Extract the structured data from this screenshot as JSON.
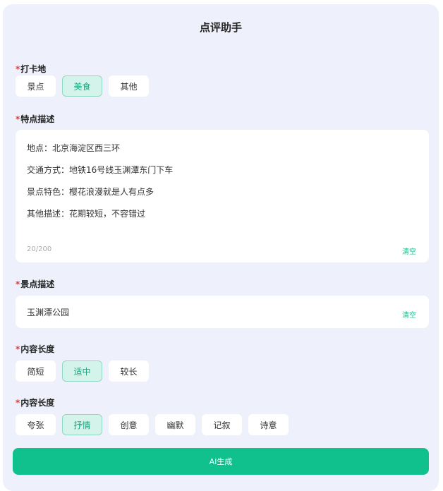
{
  "header": {
    "title": "点评助手"
  },
  "checkin": {
    "label": "打卡地",
    "options": [
      {
        "label": "景点",
        "active": false
      },
      {
        "label": "美食",
        "active": true
      },
      {
        "label": "其他",
        "active": false
      }
    ]
  },
  "features": {
    "label": "特点描述",
    "lines": [
      "地点：北京海淀区西三环",
      "交通方式：地铁16号线玉渊潭东门下车",
      "景点特色：樱花浪漫就是人有点多",
      "其他描述：花期较短，不容错过"
    ],
    "counter": "20/200",
    "clear_label": "清空"
  },
  "spot": {
    "label": "景点描述",
    "value": "玉渊潭公园",
    "clear_label": "清空"
  },
  "length": {
    "label": "内容长度",
    "options": [
      {
        "label": "简短",
        "active": false
      },
      {
        "label": "适中",
        "active": true
      },
      {
        "label": "较长",
        "active": false
      }
    ]
  },
  "style": {
    "label": "内容长度",
    "options": [
      {
        "label": "夸张",
        "active": false
      },
      {
        "label": "抒情",
        "active": true
      },
      {
        "label": "创意",
        "active": false
      },
      {
        "label": "幽默",
        "active": false
      },
      {
        "label": "记叙",
        "active": false
      },
      {
        "label": "诗意",
        "active": false
      }
    ]
  },
  "required_mark": "*",
  "generate": {
    "label": "AI生成"
  }
}
